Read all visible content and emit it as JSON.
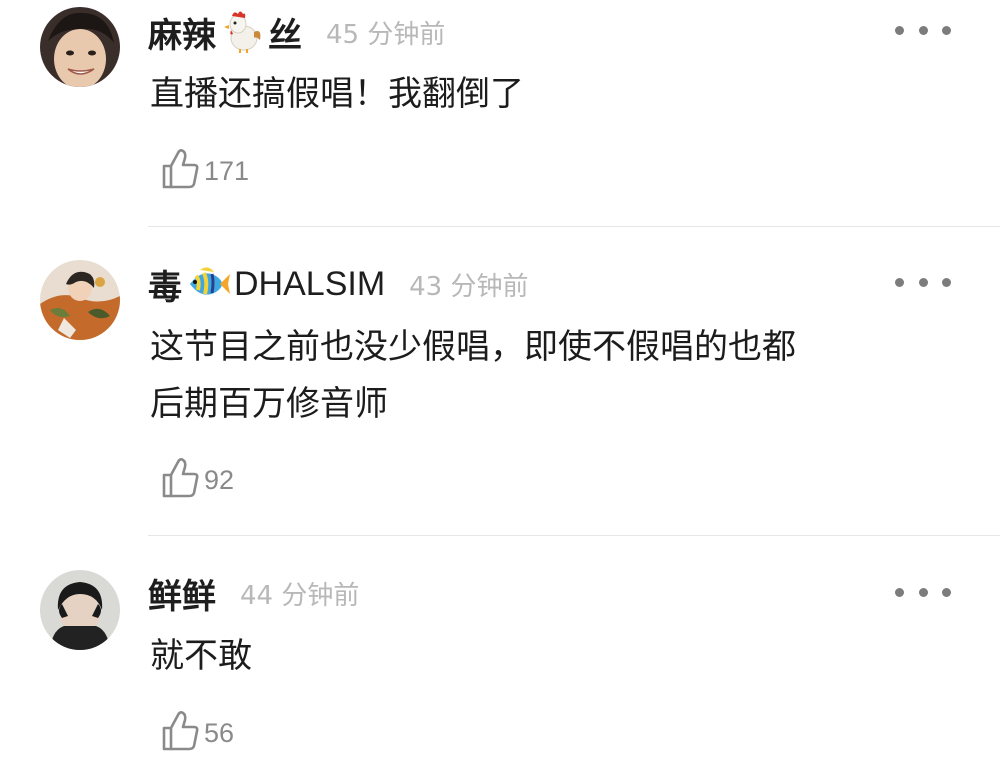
{
  "comments": [
    {
      "username_prefix": "麻辣",
      "username_emoji": "rooster-emoji-icon",
      "username_suffix": "丝",
      "timestamp": "45 分钟前",
      "text_lines": [
        "直播还搞假唱！我翻倒了"
      ],
      "like_count": "171",
      "more_icon": "more-dots-icon"
    },
    {
      "username_prefix": "毒",
      "username_emoji": "tropical-fish-emoji-icon",
      "username_suffix": "DHALSIM",
      "timestamp": "43 分钟前",
      "text_lines": [
        "这节目之前也没少假唱，即使不假唱的也都",
        "后期百万修音师"
      ],
      "like_count": "92",
      "more_icon": "more-dots-icon"
    },
    {
      "username_prefix": "鲜鲜",
      "username_emoji": "",
      "username_suffix": "",
      "timestamp": "44 分钟前",
      "text_lines": [
        "就不敢"
      ],
      "like_count": "56",
      "more_icon": "more-dots-icon"
    }
  ],
  "colors": {
    "username": "#1e1e1e",
    "timestamp": "#b8b8b8",
    "like_count": "#8a8a8a",
    "divider": "#e6e6e6",
    "more_dots": "#7c7c7c"
  }
}
